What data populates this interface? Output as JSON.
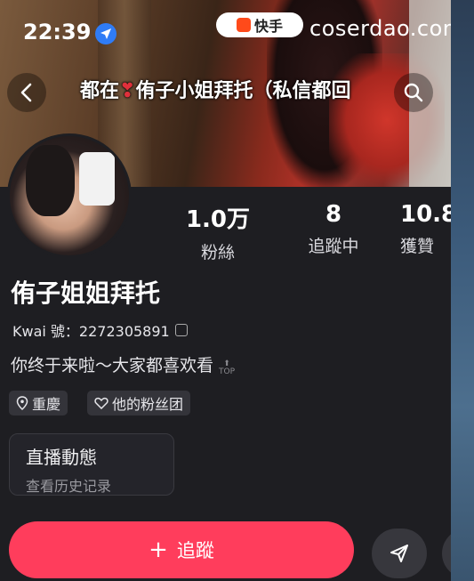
{
  "status_bar": {
    "time": "22:39",
    "watermark": "coserdao.com"
  },
  "app_badge": {
    "label": "快手",
    "icon": "kuaishou-logo-icon"
  },
  "cover": {
    "caption_prefix": "都在",
    "caption_suffix": "侑子小姐拜托（私信都回",
    "caption_icon": "heart-icon"
  },
  "stats": {
    "fans": {
      "value": "1.0万",
      "label": "粉絲"
    },
    "following": {
      "value": "8",
      "label": "追蹤中"
    },
    "likes": {
      "value": "10.8",
      "label": "獲贊"
    }
  },
  "profile": {
    "name": "侑子姐姐拜托",
    "kwai_id": "Kwai 號：2272305891",
    "bio": "你终于来啦～大家都喜欢看",
    "top_label": "TOP"
  },
  "tags": {
    "location": "重慶",
    "fan_group": "他的粉丝团"
  },
  "live_card": {
    "title": "直播動態",
    "subtitle": "查看历史记录"
  },
  "actions": {
    "follow_label": "追蹤",
    "follow_prefix": "+"
  },
  "colors": {
    "accent": "#ff3d5c",
    "background": "#1e1e22",
    "location_badge": "#2f7cf6"
  }
}
